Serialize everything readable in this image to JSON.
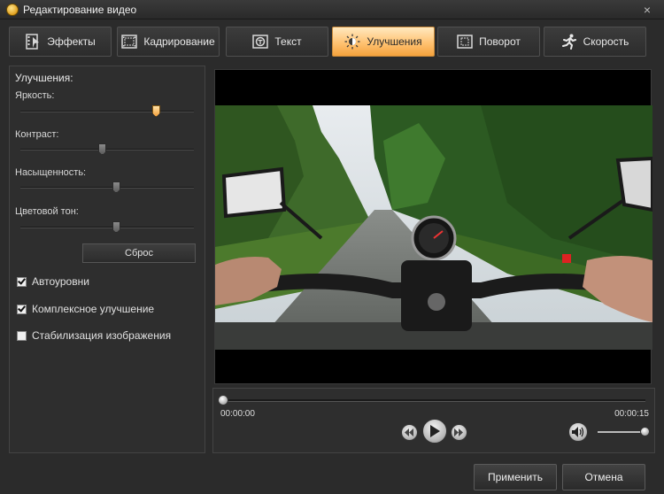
{
  "window": {
    "title": "Редактирование видео",
    "close_glyph": "×"
  },
  "tabs": [
    {
      "label": "Эффекты",
      "icon": "film-effects-icon",
      "active": false
    },
    {
      "label": "Кадрирование",
      "icon": "crop-frame-icon",
      "active": false
    },
    {
      "label": "Текст",
      "icon": "text-icon",
      "active": false
    },
    {
      "label": "Улучшения",
      "icon": "brightness-sun-icon",
      "active": true
    },
    {
      "label": "Поворот",
      "icon": "rotate-icon",
      "active": false
    },
    {
      "label": "Скорость",
      "icon": "running-man-icon",
      "active": false
    }
  ],
  "enhance": {
    "section_title": "Улучшения:",
    "sliders": [
      {
        "label": "Яркость:",
        "value_fraction": 0.78,
        "highlighted": true
      },
      {
        "label": "Контраст:",
        "value_fraction": 0.47,
        "highlighted": false
      },
      {
        "label": "Насыщенность:",
        "value_fraction": 0.55,
        "highlighted": false
      },
      {
        "label": "Цветовой тон:",
        "value_fraction": 0.55,
        "highlighted": false
      }
    ],
    "reset_label": "Сброс",
    "checkboxes": [
      {
        "label": "Автоуровни",
        "checked": true
      },
      {
        "label": "Комплексное улучшение",
        "checked": true
      },
      {
        "label": "Стабилизация изображения",
        "checked": false
      }
    ]
  },
  "player": {
    "time_current": "00:00:00",
    "time_total": "00:00:15",
    "seek_fraction": 0.0,
    "volume_fraction": 0.95
  },
  "buttons": {
    "apply": "Применить",
    "cancel": "Отмена"
  },
  "colors": {
    "accent": "#ffc272",
    "background": "#2b2b2b"
  }
}
